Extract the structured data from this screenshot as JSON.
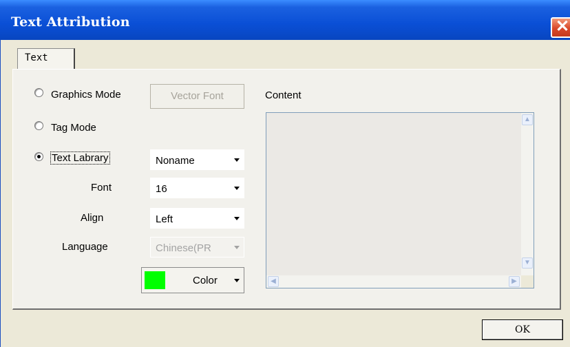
{
  "window": {
    "title": "Text Attribution",
    "close_glyph": "✕"
  },
  "tabs": [
    {
      "label": "Text",
      "selected": true
    }
  ],
  "modes": [
    {
      "label": "Graphics Mode",
      "checked": false
    },
    {
      "label": "Tag Mode",
      "checked": false
    },
    {
      "label": "Text Labrary",
      "checked": true
    }
  ],
  "vector_font_button": {
    "label": "Vector Font",
    "enabled": false
  },
  "library_select": {
    "value": "Noname"
  },
  "font": {
    "label": "Font",
    "value": "16"
  },
  "align": {
    "label": "Align",
    "value": "Left"
  },
  "language": {
    "label": "Language",
    "value": "Chinese(PR",
    "enabled": false
  },
  "color": {
    "label": "Color",
    "swatch": "#00ff00"
  },
  "content": {
    "label": "Content",
    "value": ""
  },
  "ok_button": {
    "label": "OK"
  },
  "colors": {
    "titlebar": "#0a4fd6",
    "dialog_bg": "#ece9d8",
    "close_button": "#d9482a"
  }
}
